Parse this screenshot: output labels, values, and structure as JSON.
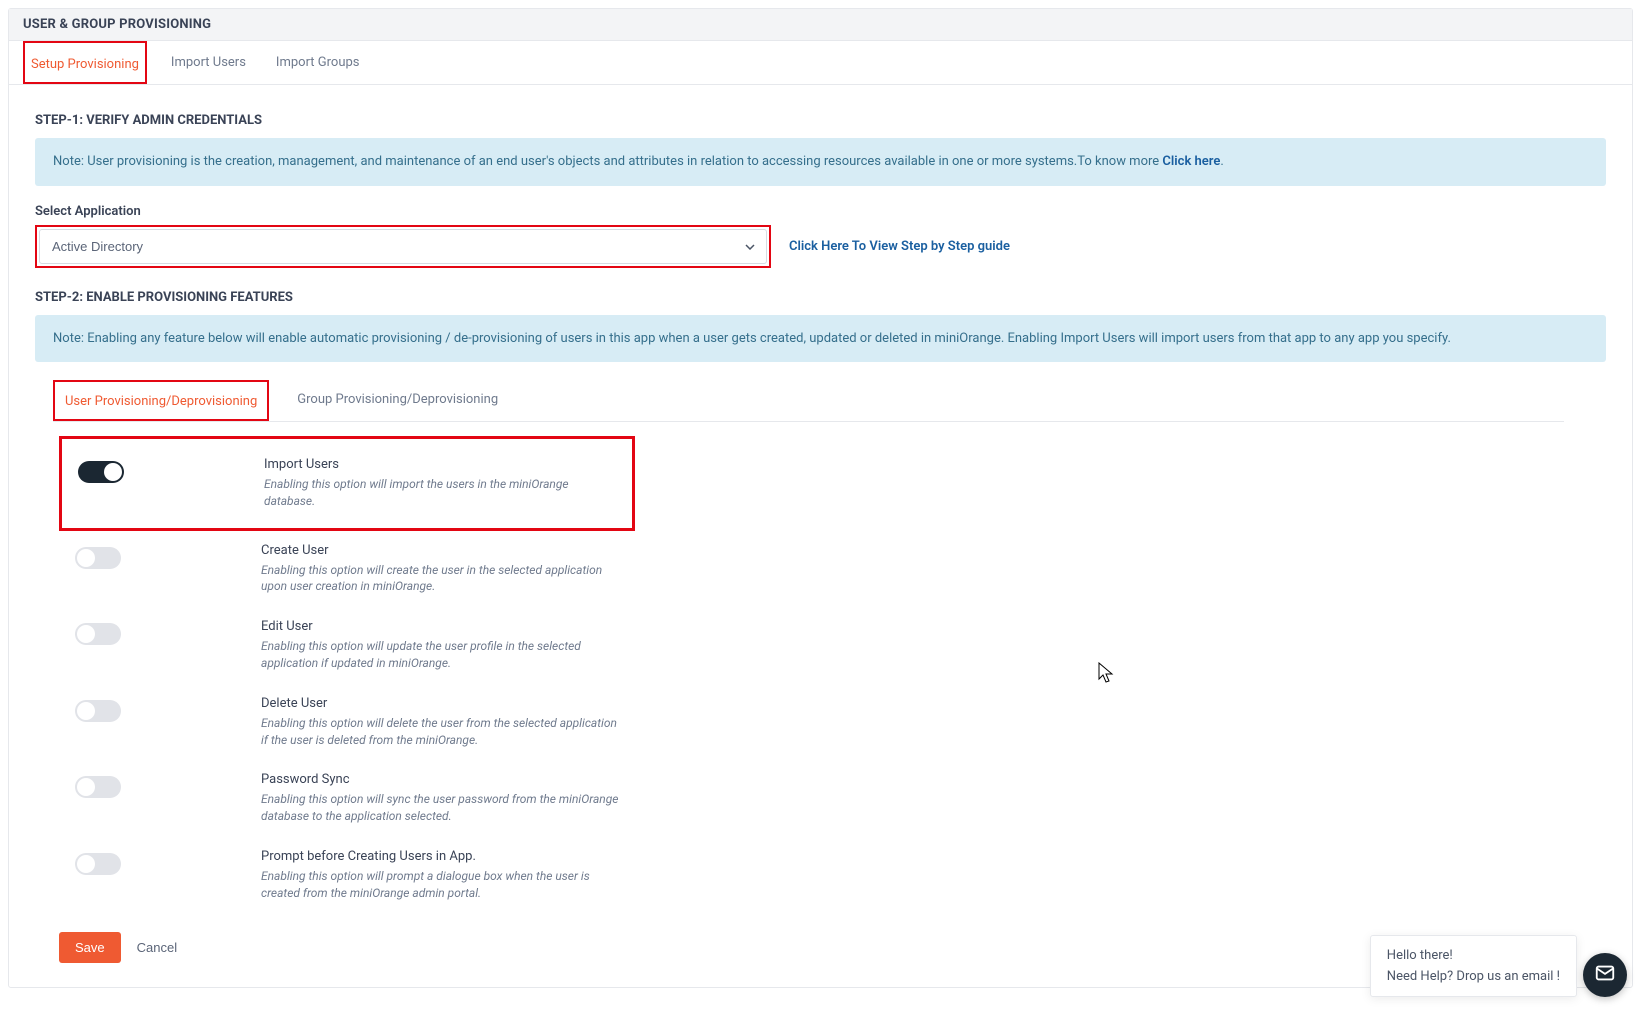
{
  "page_title": "USER & GROUP PROVISIONING",
  "top_tabs": [
    {
      "label": "Setup Provisioning",
      "active": true
    },
    {
      "label": "Import Users",
      "active": false
    },
    {
      "label": "Import Groups",
      "active": false
    }
  ],
  "step1": {
    "heading": "STEP-1: VERIFY ADMIN CREDENTIALS",
    "note_prefix": "Note: User provisioning is the creation, management, and maintenance of an end user's objects and attributes in relation to accessing resources available in one or more systems.To know more ",
    "note_link": "Click here",
    "note_suffix": ".",
    "select_label": "Select Application",
    "select_value": "Active Directory",
    "guide_link": "Click Here To View Step by Step guide"
  },
  "step2": {
    "heading": "STEP-2: ENABLE PROVISIONING FEATURES",
    "note": "Note: Enabling any feature below will enable automatic provisioning / de-provisioning of users in this app when a user gets created, updated or deleted in miniOrange. Enabling Import Users will import users from that app to any app you specify."
  },
  "sub_tabs": [
    {
      "label": "User Provisioning/Deprovisioning",
      "active": true
    },
    {
      "label": "Group Provisioning/Deprovisioning",
      "active": false
    }
  ],
  "features": [
    {
      "title": "Import Users",
      "desc": "Enabling this option will import the users in the miniOrange database.",
      "on": true,
      "highlight": true
    },
    {
      "title": "Create User",
      "desc": "Enabling this option will create the user in the selected application upon user creation in miniOrange.",
      "on": false
    },
    {
      "title": "Edit User",
      "desc": "Enabling this option will update the user profile in the selected application if updated in miniOrange.",
      "on": false
    },
    {
      "title": "Delete User",
      "desc": "Enabling this option will delete the user from the selected application if the user is deleted from the miniOrange.",
      "on": false
    },
    {
      "title": "Password Sync",
      "desc": "Enabling this option will sync the user password from the miniOrange database to the application selected.",
      "on": false
    },
    {
      "title": "Prompt before Creating Users in App.",
      "desc": "Enabling this option will prompt a dialogue box when the user is created from the miniOrange admin portal.",
      "on": false
    }
  ],
  "actions": {
    "save": "Save",
    "cancel": "Cancel"
  },
  "chat": {
    "line1": "Hello there!",
    "line2": "Need Help? Drop us an email !"
  }
}
